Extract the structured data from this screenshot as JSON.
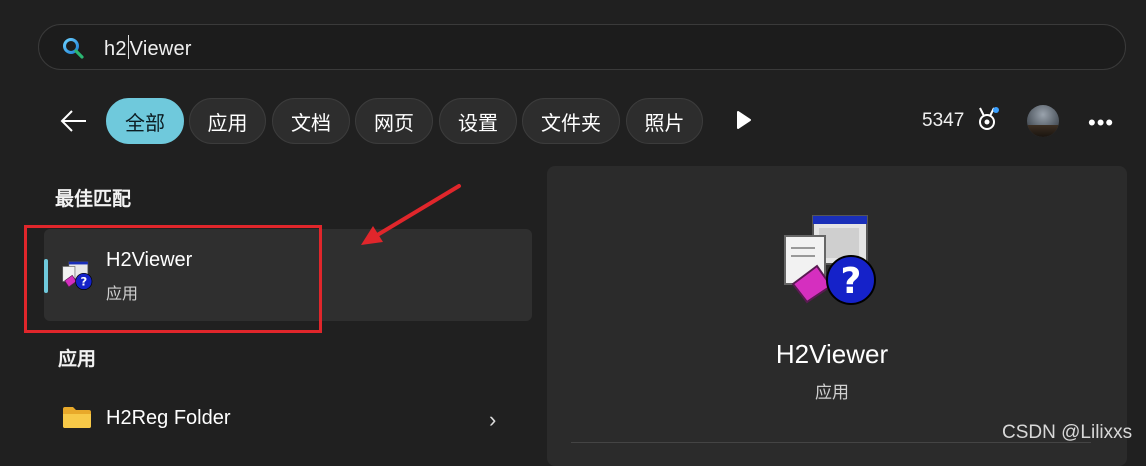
{
  "search": {
    "text_before_caret": "h2",
    "text_after_caret": "Viewer"
  },
  "filters": [
    "全部",
    "应用",
    "文档",
    "网页",
    "设置",
    "文件夹",
    "照片"
  ],
  "header": {
    "points": "5347"
  },
  "best_match": {
    "section_title": "最佳匹配",
    "name": "H2Viewer",
    "type": "应用"
  },
  "apps": {
    "section_title": "应用",
    "items": [
      {
        "name": "H2Reg Folder"
      }
    ]
  },
  "preview": {
    "name": "H2Viewer",
    "type": "应用"
  },
  "watermark": "CSDN @Lilixxs",
  "colors": {
    "accent": "#6fc9dc",
    "annotation_red": "#e0262b",
    "background": "#202020"
  },
  "icons": [
    "search-icon",
    "back-arrow-icon",
    "play-icon",
    "medal-icon",
    "avatar",
    "more-icon",
    "help-viewer-icon",
    "folder-icon",
    "chevron-right-icon"
  ]
}
